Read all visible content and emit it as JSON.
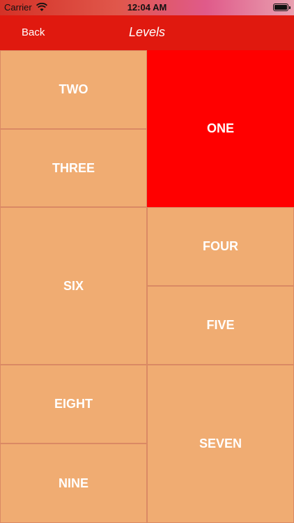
{
  "status_bar": {
    "carrier": "Carrier",
    "time": "12:04 AM",
    "icons": [
      "wifi-icon",
      "battery-icon"
    ]
  },
  "nav": {
    "back_label": "Back",
    "title": "Levels",
    "color": "#e0190f"
  },
  "levels": {
    "one": "ONE",
    "two": "TWO",
    "three": "THREE",
    "four": "FOUR",
    "five": "FIVE",
    "six": "SIX",
    "seven": "SEVEN",
    "eight": "EIGHT",
    "nine": "NINE",
    "selected": "ONE",
    "tile_color": "#f0ac72",
    "selected_color": "#ff0000"
  }
}
